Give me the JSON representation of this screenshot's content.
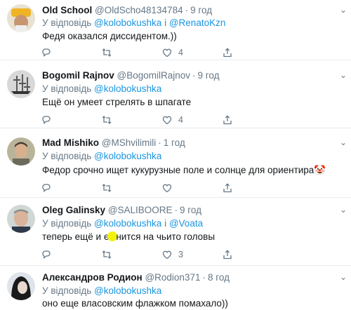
{
  "reply_prefix": "У відповідь",
  "and_word": "і",
  "tweets": [
    {
      "name": "Old School",
      "handle": "@OldScho48134784",
      "time": "9 год",
      "reply_to": [
        "@kolobokushka",
        "@RenatoKzn"
      ],
      "text": "Федя оказался диссидентом.))",
      "counts": {
        "reply": "",
        "retweet": "",
        "like": "4"
      }
    },
    {
      "name": "Bogomil Rajnov",
      "handle": "@BogomilRajnov",
      "time": "9 год",
      "reply_to": [
        "@kolobokushka"
      ],
      "text": "Ещё он умеет стрелять в шпагате",
      "counts": {
        "reply": "",
        "retweet": "",
        "like": "4"
      }
    },
    {
      "name": "Mad Mishiko",
      "handle": "@MShvilimili",
      "time": "1 год",
      "reply_to": [
        "@kolobokushka"
      ],
      "text": "Федор срочно ищет кукурузные поле и солнце для ориентира",
      "emoji": "🤡",
      "counts": {
        "reply": "",
        "retweet": "",
        "like": ""
      }
    },
    {
      "name": "Oleg Galinsky",
      "handle": "@SALIBOORE",
      "time": "9 год",
      "reply_to": [
        "@kolobokushka",
        "@Voata"
      ],
      "text_before": "теперь ещё и ",
      "text_after": "нится на чьито  головы",
      "text_hidden_char": "е",
      "counts": {
        "reply": "",
        "retweet": "",
        "like": "3"
      }
    },
    {
      "name": "Александров Родион",
      "handle": "@Rodion371",
      "time": "8 год",
      "reply_to": [
        "@kolobokushka"
      ],
      "text": "оно еще власовским флажком помахало))"
    }
  ],
  "colors": {
    "link": "#1b95e0",
    "muted": "#657786",
    "text": "#14171a",
    "divider": "#e6ecf0",
    "highlight": "#f2f20a"
  },
  "icons": [
    "reply-icon",
    "retweet-icon",
    "like-icon",
    "share-icon",
    "chevron-down-icon"
  ]
}
